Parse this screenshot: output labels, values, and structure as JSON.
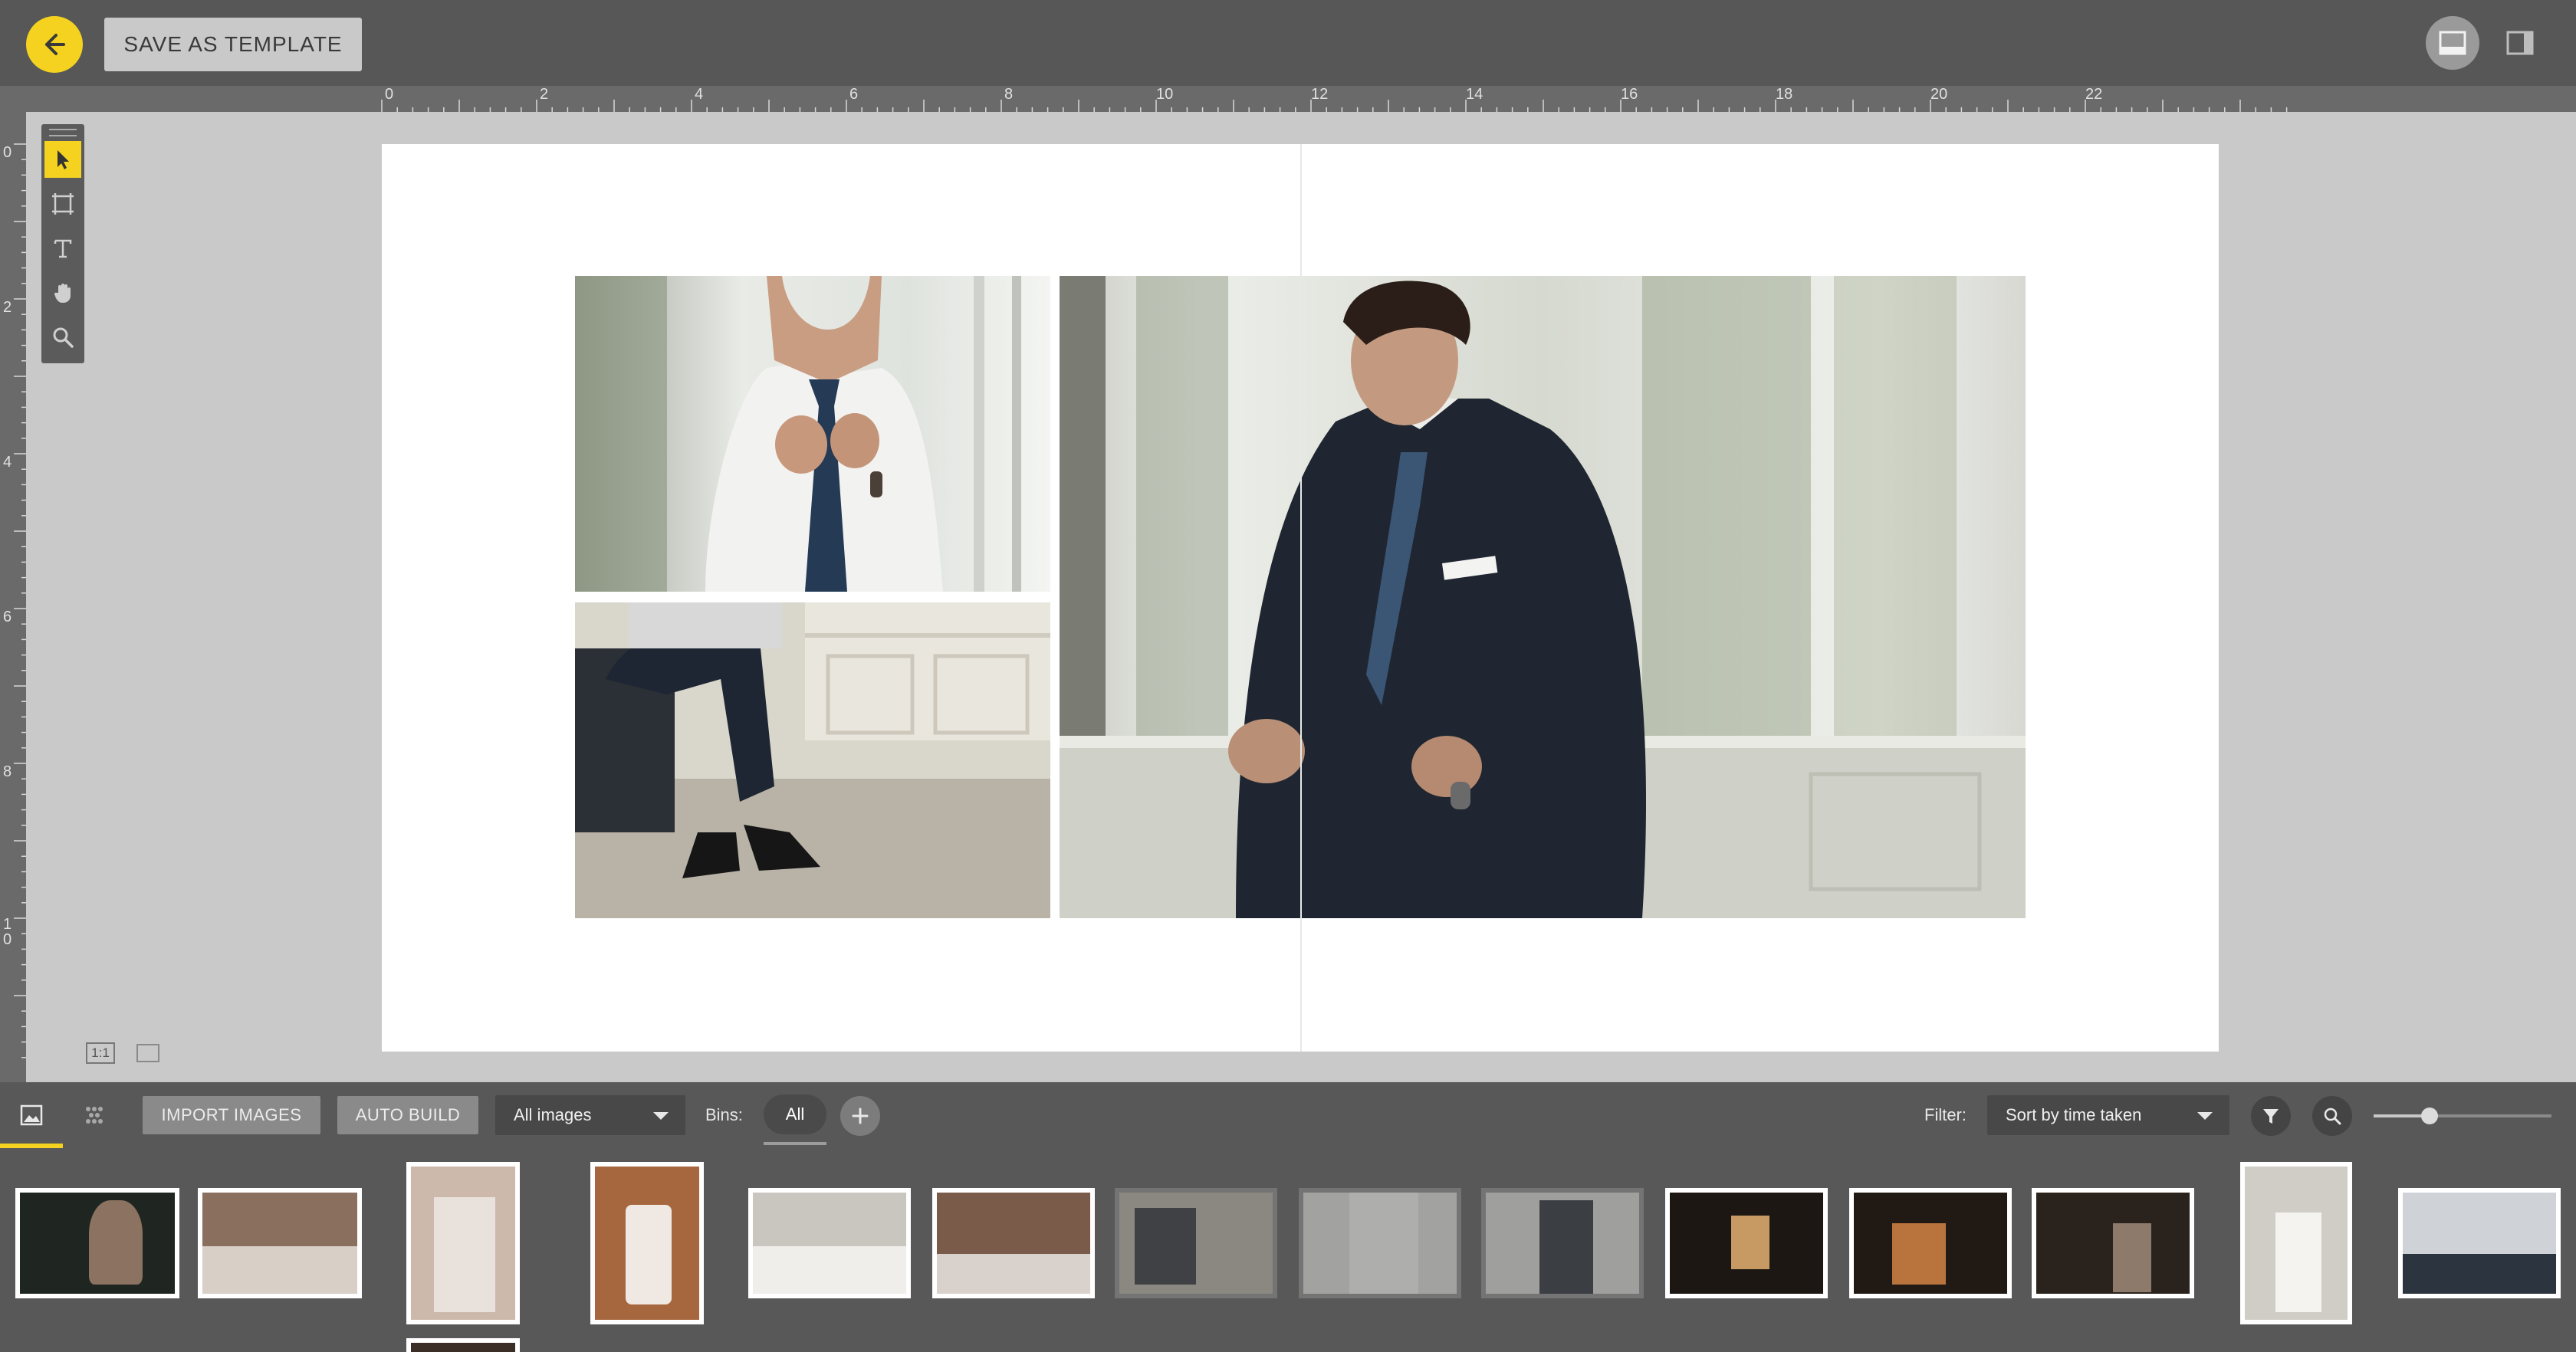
{
  "topbar": {
    "save_template_label": "SAVE AS TEMPLATE",
    "back_icon": "arrow-left-icon",
    "view_icons": [
      "layout-bottom-panel-icon",
      "layout-side-panel-icon"
    ]
  },
  "rulers": {
    "horizontal_labels": [
      "0",
      "2",
      "4",
      "6",
      "8",
      "10",
      "12",
      "14",
      "16",
      "18",
      "20",
      "22"
    ],
    "vertical_labels": [
      "0",
      "2",
      "4",
      "6",
      "8",
      "1\n0"
    ]
  },
  "tools": [
    "pointer-icon",
    "frame-icon",
    "text-icon",
    "hand-icon",
    "zoom-icon"
  ],
  "canvas": {
    "zoom_ratio_label": "1:1",
    "accent_color": "#f4d21f"
  },
  "bottom_toolbar": {
    "import_label": "IMPORT IMAGES",
    "autobuild_label": "AUTO BUILD",
    "images_select_value": "All images",
    "bins_label": "Bins:",
    "bin_all_label": "All",
    "filter_label": "Filter:",
    "sort_select_value": "Sort by time taken"
  }
}
